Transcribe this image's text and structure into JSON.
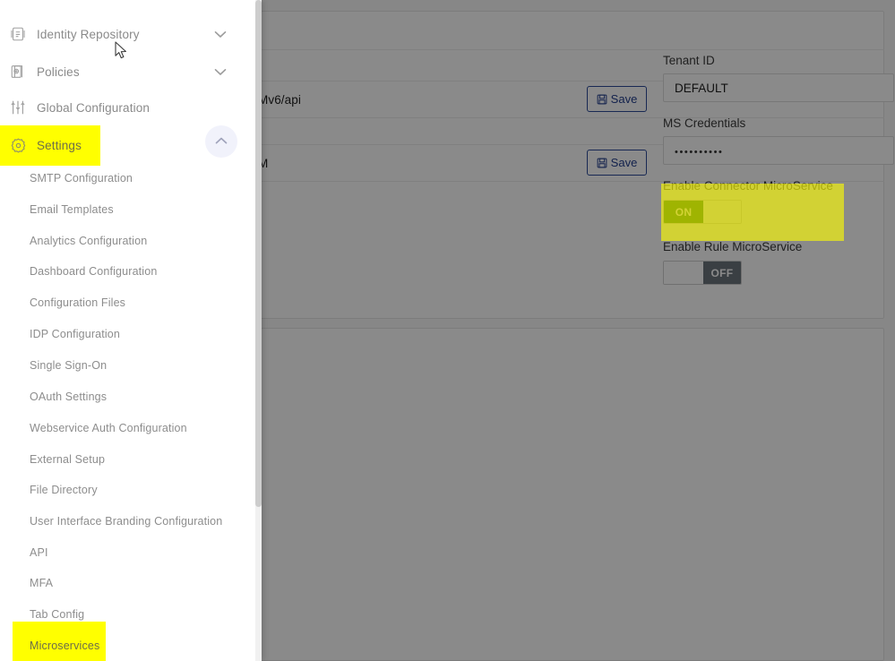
{
  "sidebar": {
    "nav_items": [
      {
        "label": "Identity Repository",
        "icon": "identity-repository-icon",
        "expandable": true,
        "chevron": "chevron-down"
      },
      {
        "label": "Policies",
        "icon": "policies-icon",
        "expandable": true,
        "chevron": "chevron-down"
      },
      {
        "label": "Global Configuration",
        "icon": "sliders-icon",
        "expandable": false,
        "chevron": ""
      },
      {
        "label": "Settings",
        "icon": "gear-icon",
        "expandable": true,
        "chevron": "chevron-up",
        "highlighted": true,
        "expanded": true
      }
    ],
    "sub_items": [
      {
        "label": "SMTP Configuration"
      },
      {
        "label": "Email Templates"
      },
      {
        "label": "Analytics Configuration"
      },
      {
        "label": "Dashboard Configuration"
      },
      {
        "label": "Configuration Files"
      },
      {
        "label": "IDP Configuration"
      },
      {
        "label": "Single Sign-On"
      },
      {
        "label": "OAuth Settings"
      },
      {
        "label": "Webservice Auth Configuration"
      },
      {
        "label": "External Setup"
      },
      {
        "label": "File Directory"
      },
      {
        "label": "User Interface Branding Configuration"
      },
      {
        "label": "API"
      },
      {
        "label": "MFA"
      },
      {
        "label": "Tab Config"
      },
      {
        "label": "Microservices",
        "highlighted": true
      }
    ],
    "collapse_button": {
      "icon": "chevron-up-icon"
    }
  },
  "main": {
    "form_rows": [
      {
        "value": "Mv6/api",
        "save_label": "Save",
        "save_icon": "floppy-disk-icon"
      },
      {
        "value": "M",
        "save_label": "Save",
        "save_icon": "floppy-disk-icon"
      }
    ],
    "right_panel": {
      "tenant_id": {
        "label": "Tenant ID",
        "value": "DEFAULT"
      },
      "ms_credentials": {
        "label": "MS Credentials",
        "value": "••••••••••"
      },
      "connector_microservice": {
        "label": "Enable Connector MicroService",
        "state": "ON",
        "highlighted": true
      },
      "rule_microservice": {
        "label": "Enable Rule MicroService",
        "state": "OFF",
        "highlighted": false
      }
    }
  },
  "colors": {
    "highlight_yellow": "#ffff00",
    "toggle_on_green": "#0b6b0b",
    "toggle_off_gray": "#6c757d",
    "save_button_blue": "#24408e",
    "scrim": "rgba(0,0,0,0.46)"
  }
}
